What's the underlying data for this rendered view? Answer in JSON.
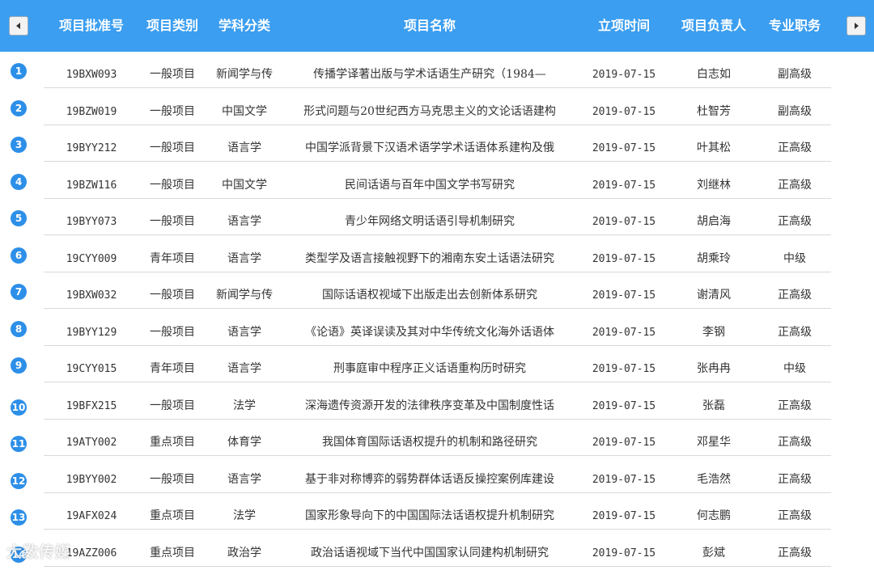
{
  "header": {
    "columns": [
      "项目批准号",
      "项目类别",
      "学科分类",
      "项目名称",
      "立项时间",
      "项目负责人",
      "专业职务"
    ],
    "prev_icon": "chevron-left-icon",
    "next_icon": "chevron-right-icon"
  },
  "rows": [
    {
      "num": "1",
      "id": "19BXW093",
      "type": "一般项目",
      "subject": "新闻学与传",
      "name": "传播学译著出版与学术话语生产研究（1984—",
      "date": "2019-07-15",
      "leader": "白志如",
      "title": "副高级"
    },
    {
      "num": "2",
      "id": "19BZW019",
      "type": "一般项目",
      "subject": "中国文学",
      "name": "形式问题与20世纪西方马克思主义的文论话语建构",
      "date": "2019-07-15",
      "leader": "杜智芳",
      "title": "副高级"
    },
    {
      "num": "3",
      "id": "19BYY212",
      "type": "一般项目",
      "subject": "语言学",
      "name": "中国学派背景下汉语术语学学术话语体系建构及俄",
      "date": "2019-07-15",
      "leader": "叶其松",
      "title": "正高级"
    },
    {
      "num": "4",
      "id": "19BZW116",
      "type": "一般项目",
      "subject": "中国文学",
      "name": "民间话语与百年中国文学书写研究",
      "date": "2019-07-15",
      "leader": "刘继林",
      "title": "正高级"
    },
    {
      "num": "5",
      "id": "19BYY073",
      "type": "一般项目",
      "subject": "语言学",
      "name": "青少年网络文明话语引导机制研究",
      "date": "2019-07-15",
      "leader": "胡启海",
      "title": "正高级"
    },
    {
      "num": "6",
      "id": "19CYY009",
      "type": "青年项目",
      "subject": "语言学",
      "name": "类型学及语言接触视野下的湘南东安土话语法研究",
      "date": "2019-07-15",
      "leader": "胡乘玲",
      "title": "中级"
    },
    {
      "num": "7",
      "id": "19BXW032",
      "type": "一般项目",
      "subject": "新闻学与传",
      "name": "国际话语权视域下出版走出去创新体系研究",
      "date": "2019-07-15",
      "leader": "谢清风",
      "title": "正高级"
    },
    {
      "num": "8",
      "id": "19BYY129",
      "type": "一般项目",
      "subject": "语言学",
      "name": "《论语》英译误读及其对中华传统文化海外话语体",
      "date": "2019-07-15",
      "leader": "李钢",
      "title": "正高级"
    },
    {
      "num": "9",
      "id": "19CYY015",
      "type": "青年项目",
      "subject": "语言学",
      "name": "刑事庭审中程序正义话语重构历时研究",
      "date": "2019-07-15",
      "leader": "张冉冉",
      "title": "中级"
    },
    {
      "num": "10",
      "id": "19BFX215",
      "type": "一般项目",
      "subject": "法学",
      "name": "深海遗传资源开发的法律秩序变革及中国制度性话",
      "date": "2019-07-15",
      "leader": "张磊",
      "title": "正高级"
    },
    {
      "num": "11",
      "id": "19ATY002",
      "type": "重点项目",
      "subject": "体育学",
      "name": "我国体育国际话语权提升的机制和路径研究",
      "date": "2019-07-15",
      "leader": "邓星华",
      "title": "正高级"
    },
    {
      "num": "12",
      "id": "19BYY002",
      "type": "一般项目",
      "subject": "语言学",
      "name": "基于非对称博弈的弱势群体话语反操控案例库建设",
      "date": "2019-07-15",
      "leader": "毛浩然",
      "title": "正高级"
    },
    {
      "num": "13",
      "id": "19AFX024",
      "type": "重点项目",
      "subject": "法学",
      "name": "国家形象导向下的中国国际法话语权提升机制研究",
      "date": "2019-07-15",
      "leader": "何志鹏",
      "title": "正高级"
    },
    {
      "num": "14",
      "id": "19AZZ006",
      "type": "重点项目",
      "subject": "政治学",
      "name": "政治话语视域下当代中国国家认同建构机制研究",
      "date": "2019-07-15",
      "leader": "彭斌",
      "title": "正高级"
    }
  ],
  "watermark": "大数传媒"
}
